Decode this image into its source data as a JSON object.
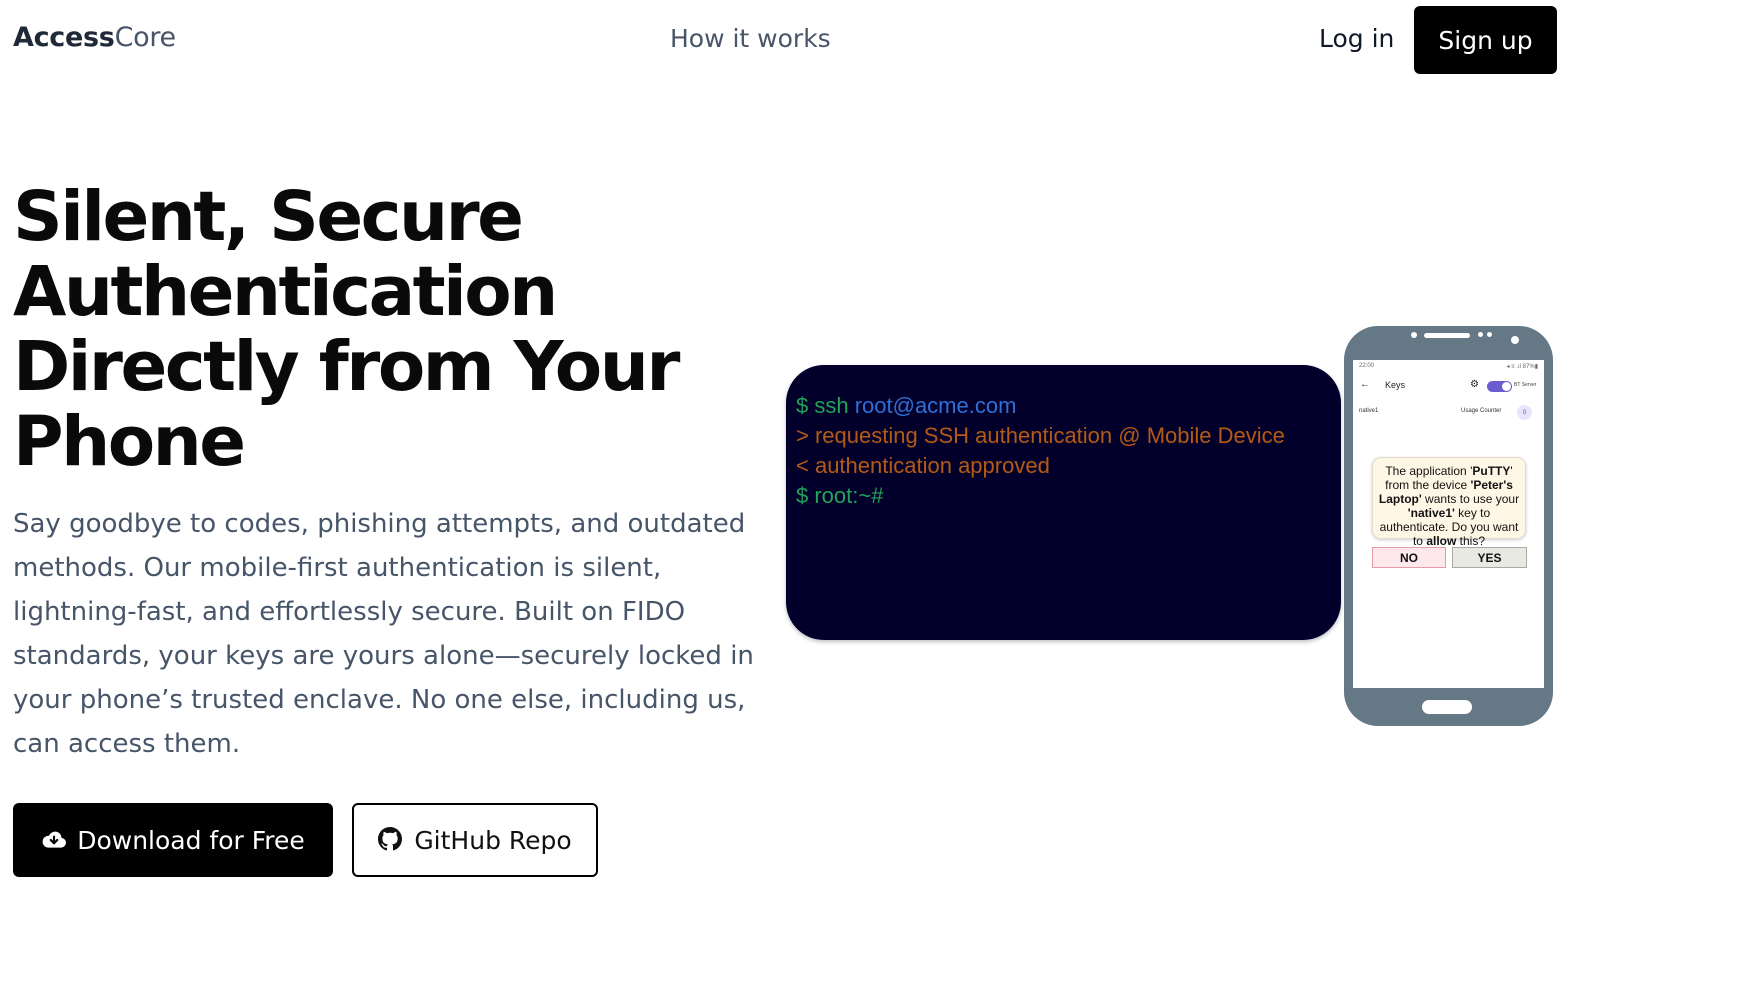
{
  "header": {
    "logo_bold": "Access",
    "logo_light": "Core",
    "nav_link": "How it works",
    "login_label": "Log in",
    "signup_label": "Sign up"
  },
  "hero": {
    "title_lines": [
      "Silent, Secure",
      "Authentication",
      "Directly from Your",
      "Phone"
    ],
    "subtitle": "Say goodbye to codes, phishing attempts, and outdated methods. Our mobile-first authentication is silent, lightning-fast, and effortlessly secure. Built on FIDO standards, your keys are yours alone—securely locked in your phone’s trusted enclave. No one else, including us, can access them.",
    "download_label": "Download for Free",
    "download_icon": "cloud-download-icon",
    "github_label": "GitHub Repo",
    "github_icon": "github-icon"
  },
  "terminal": {
    "line1_prompt": "$ ssh ",
    "line1_host": "root@acme.com",
    "line2": " > requesting SSH authentication @ Mobile Device",
    "line3": " < authentication approved",
    "line4": "$ root:~#",
    "colors": {
      "background": "#02002b",
      "prompt": "#22a35a",
      "host": "#2f6fd6",
      "log": "#b55a14"
    }
  },
  "phone": {
    "status_time": "22:00",
    "status_right": "◂ ≡ .ıl 87%▮",
    "back_icon": "arrow-left-icon",
    "screen_title": "Keys",
    "gear_icon": "gear-icon",
    "toggle_label": "BT Server",
    "key_name": "native1",
    "usage_counter_label": "Usage Counter",
    "usage_counter_value": "0",
    "dialog_pre_app": "The application '",
    "dialog_app": "PuTTY",
    "dialog_mid1": "' from the device ",
    "dialog_device": "'Peter's Laptop'",
    "dialog_mid2": " wants to use your ",
    "dialog_key": "'native1'",
    "dialog_mid3": " key to authenticate. Do you want to ",
    "dialog_allow": "allow",
    "dialog_end": " this?",
    "no_label": "NO",
    "yes_label": "YES"
  }
}
